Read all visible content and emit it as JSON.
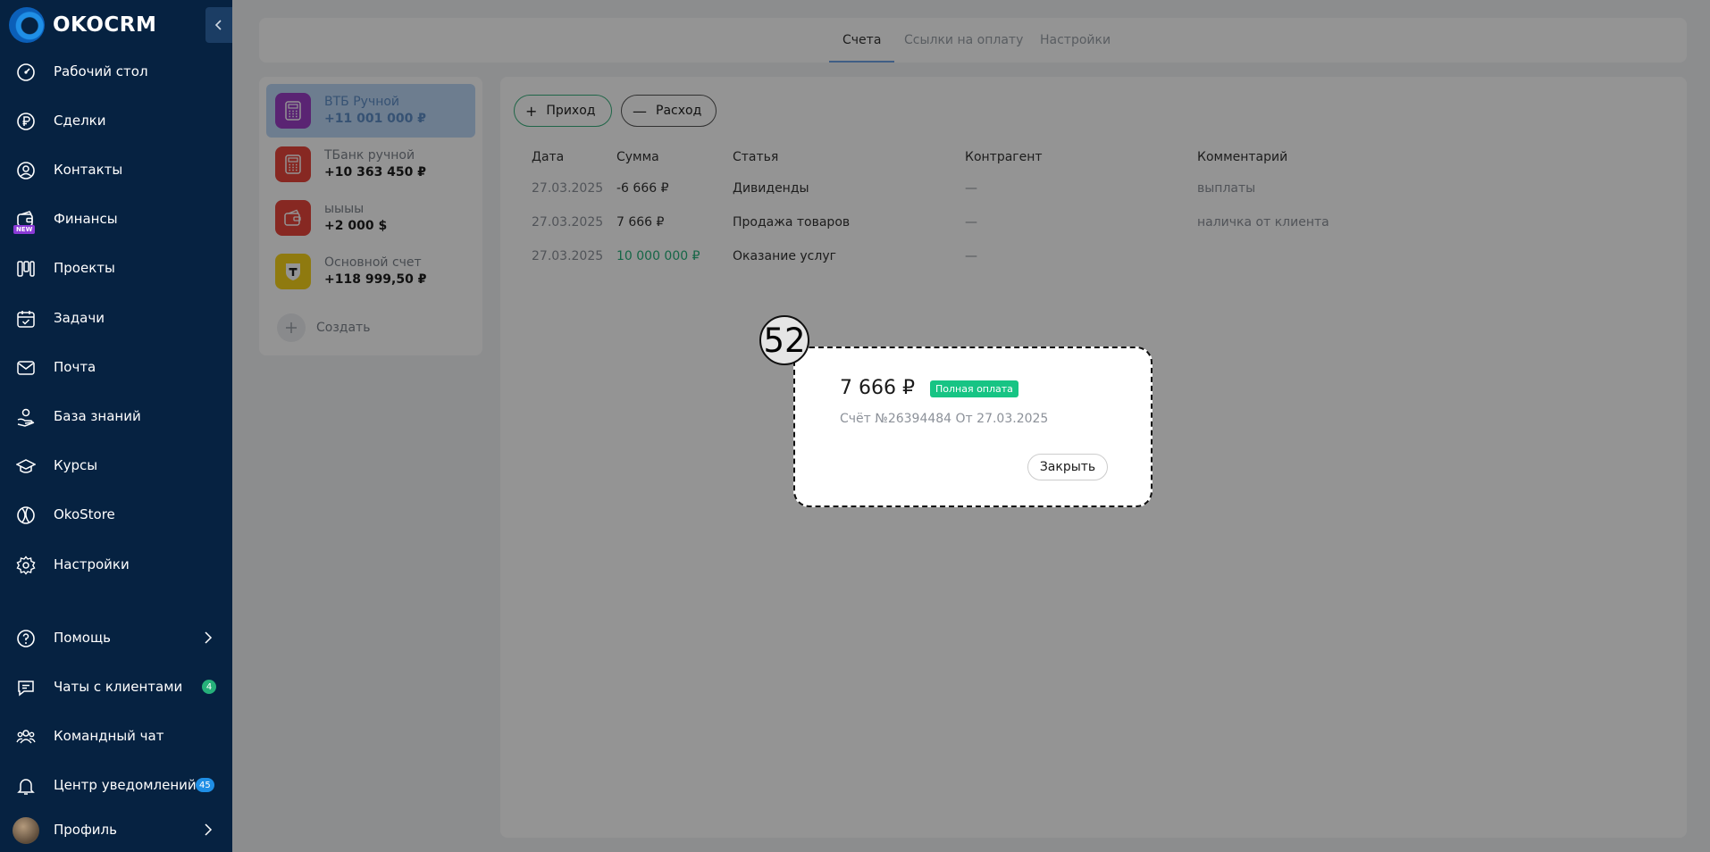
{
  "app": {
    "logo_text": "OKOCRM"
  },
  "sidebar": {
    "items": [
      {
        "label": "Рабочий стол",
        "icon": "dashboard-icon"
      },
      {
        "label": "Сделки",
        "icon": "ruble-icon"
      },
      {
        "label": "Контакты",
        "icon": "contact-icon"
      },
      {
        "label": "Финансы",
        "icon": "wallet-icon",
        "badge": "NEW"
      },
      {
        "label": "Проекты",
        "icon": "kanban-icon"
      },
      {
        "label": "Задачи",
        "icon": "calendar-icon"
      },
      {
        "label": "Почта",
        "icon": "mail-icon"
      },
      {
        "label": "База знаний",
        "icon": "knowledge-icon"
      },
      {
        "label": "Курсы",
        "icon": "graduation-icon"
      },
      {
        "label": "OkoStore",
        "icon": "store-icon"
      },
      {
        "label": "Настройки",
        "icon": "gear-icon"
      }
    ],
    "bottom": {
      "help": "Помощь",
      "chats": "Чаты с клиентами",
      "chats_count": "4",
      "team_chat": "Командный чат",
      "notifications": "Центр уведомлений",
      "notifications_count": "45",
      "profile": "Профиль"
    }
  },
  "tabs": [
    {
      "label": "Счета",
      "active": true
    },
    {
      "label": "Ссылки на оплату",
      "active": false
    },
    {
      "label": "Настройки",
      "active": false
    }
  ],
  "accounts": {
    "items": [
      {
        "name": "ВТБ Ручной",
        "amount": "+11 001 000 ₽",
        "icon": "calculator-icon",
        "color": "#9b3fc7"
      },
      {
        "name": "ТБанк ручной",
        "amount": "+10 363 450 ₽",
        "icon": "calculator-icon",
        "color": "#e8453c"
      },
      {
        "name": "ыыыы",
        "amount": "+2 000 $",
        "icon": "wallet-icon",
        "color": "#e8453c"
      },
      {
        "name": "Основной счет",
        "amount": "+118 999,50 ₽",
        "icon": "tbank-icon",
        "color": "#f7d21b"
      }
    ],
    "create_label": "Создать"
  },
  "toolbar": {
    "income": "Приход",
    "expense": "Расход"
  },
  "table": {
    "headers": [
      "Дата",
      "Сумма",
      "Статья",
      "Контрагент",
      "Комментарий"
    ],
    "rows": [
      {
        "date": "27.03.2025",
        "amount": "-6 666 ₽",
        "article": "Дивиденды",
        "counterparty": "—",
        "comment": "выплаты"
      },
      {
        "date": "27.03.2025",
        "amount": "7 666 ₽",
        "article": "Продажа товаров",
        "counterparty": "—",
        "comment": "наличка от клиента"
      },
      {
        "date": "27.03.2025",
        "amount": "10 000 000 ₽",
        "article": "Оказание услуг",
        "counterparty": "—",
        "comment": ""
      }
    ]
  },
  "modal": {
    "amount": "7 666 ₽",
    "status": "Полная оплата",
    "invoice": "Счёт №26394484 От 27.03.2025",
    "close_label": "Закрыть",
    "step_marker": "52"
  },
  "colors": {
    "sidebar_bg": "#062241",
    "accent_green": "#17c484",
    "accent_blue": "#1f8fe6"
  }
}
